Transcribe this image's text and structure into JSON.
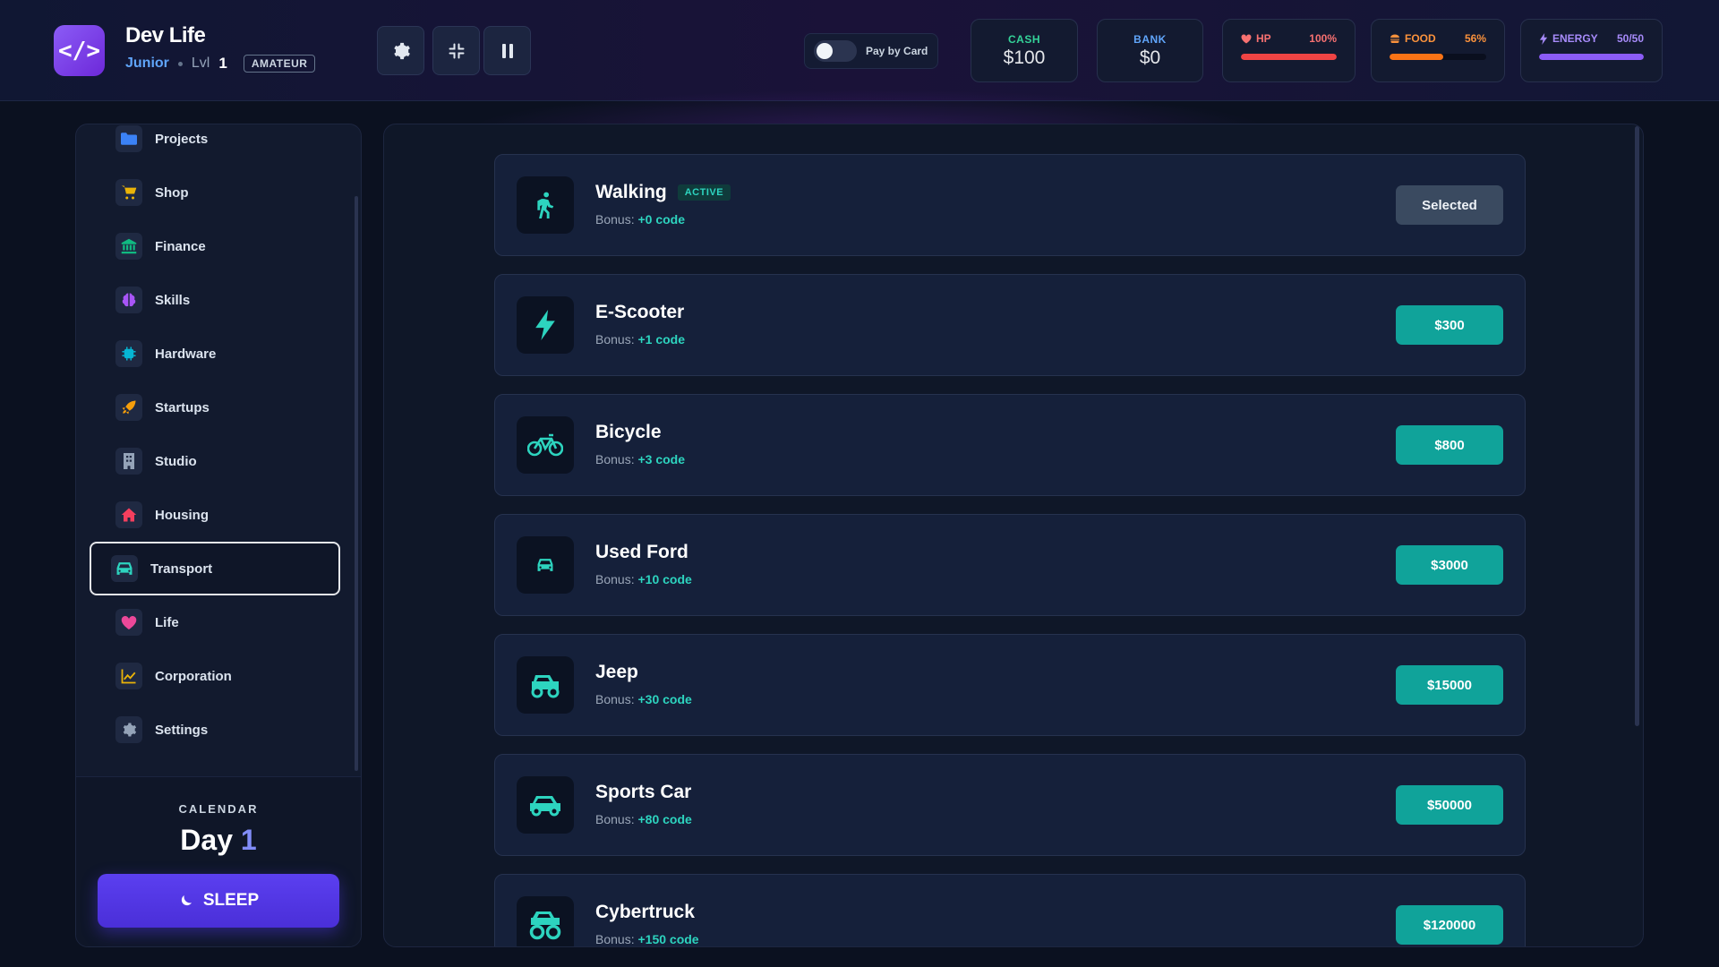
{
  "header": {
    "title": "Dev Life",
    "rank": "Junior",
    "lvl_label": "Lvl",
    "lvl": "1",
    "tier": "AMATEUR",
    "pay_by_card": "Pay by Card",
    "cash": {
      "label": "CASH",
      "value": "$100",
      "color": "#34d399"
    },
    "bank": {
      "label": "BANK",
      "value": "$0",
      "color": "#60a5fa"
    },
    "hp": {
      "label": "HP",
      "value": "100%",
      "level": 1.0,
      "color": "#ef4444"
    },
    "food": {
      "label": "FOOD",
      "value": "56%",
      "level": 0.56,
      "color": "#f97316"
    },
    "energy": {
      "label": "ENERGY",
      "value": "50/50",
      "level": 1.0,
      "color": "#8b5cf6"
    },
    "tools": [
      "gear-icon",
      "compress-icon",
      "pause-icon"
    ]
  },
  "sidebar": {
    "items": [
      {
        "label": "Projects",
        "icon": "folder-icon",
        "color": "#3b82f6"
      },
      {
        "label": "Shop",
        "icon": "cart-icon",
        "color": "#eab308"
      },
      {
        "label": "Finance",
        "icon": "bank-icon",
        "color": "#10b981"
      },
      {
        "label": "Skills",
        "icon": "brain-icon",
        "color": "#a855f7"
      },
      {
        "label": "Hardware",
        "icon": "chip-icon",
        "color": "#06b6d4"
      },
      {
        "label": "Startups",
        "icon": "rocket-icon",
        "color": "#f59e0b"
      },
      {
        "label": "Studio",
        "icon": "building-icon",
        "color": "#94a3b8"
      },
      {
        "label": "Housing",
        "icon": "house-icon",
        "color": "#f43f5e"
      },
      {
        "label": "Transport",
        "icon": "car-icon",
        "color": "#2dd4bf",
        "active": true
      },
      {
        "label": "Life",
        "icon": "heart-icon",
        "color": "#ec4899"
      },
      {
        "label": "Corporation",
        "icon": "chart-line-icon",
        "color": "#eab308"
      },
      {
        "label": "Settings",
        "icon": "gear-icon",
        "color": "#94a3b8"
      }
    ],
    "calendar_label": "CALENDAR",
    "day_label": "Day",
    "day_num": "1",
    "sleep_label": "SLEEP"
  },
  "transport": {
    "bonus_label": "Bonus:",
    "active_badge": "ACTIVE",
    "items": [
      {
        "name": "Walking",
        "bonus": "+0 code",
        "button": "Selected",
        "icon": "walking-icon",
        "active": true
      },
      {
        "name": "E-Scooter",
        "bonus": "+1 code",
        "button": "$300",
        "icon": "bolt-icon"
      },
      {
        "name": "Bicycle",
        "bonus": "+3 code",
        "button": "$800",
        "icon": "bicycle-icon"
      },
      {
        "name": "Used Ford",
        "bonus": "+10 code",
        "button": "$3000",
        "icon": "car-icon"
      },
      {
        "name": "Jeep",
        "bonus": "+30 code",
        "button": "$15000",
        "icon": "truck-icon"
      },
      {
        "name": "Sports Car",
        "bonus": "+80 code",
        "button": "$50000",
        "icon": "sports-car-icon"
      },
      {
        "name": "Cybertruck",
        "bonus": "+150 code",
        "button": "$120000",
        "icon": "monster-truck-icon"
      }
    ]
  }
}
